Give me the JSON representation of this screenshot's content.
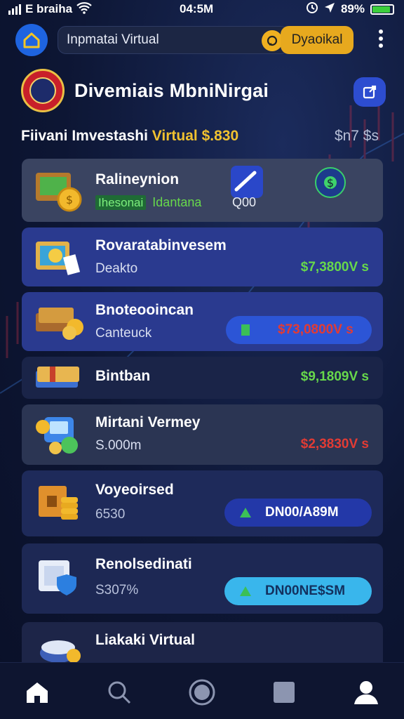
{
  "status": {
    "carrier": "E braiha",
    "time": "04:5M",
    "battery": "89%",
    "battery_level": 0.89
  },
  "topbar": {
    "search_text": "Inpmatai Virtual",
    "action_label": "Dyaoikal"
  },
  "header": {
    "title": "Divemiais MbniNirgai"
  },
  "summary": {
    "label": "Fiivani Imvestashi",
    "highlight": "Virtual $.830",
    "right_text": "$n7 $s"
  },
  "cards": [
    {
      "title": "Ralineynion",
      "sub_badge": "Ihesonai",
      "sub_text": "Idantana",
      "value": "Q00",
      "bg": "#3a4461"
    },
    {
      "title": "Rovaratabinvesem",
      "sub": "Deakto",
      "value": "$7,3800V s",
      "value_color": "#67d84b",
      "bg": "#2a3a8f"
    },
    {
      "title": "Bnoteooincan",
      "sub": "Canteuck",
      "value": "$73,0800V s",
      "value_color": "#e23b34",
      "bg": "#2a3a8f"
    },
    {
      "title": "Bintban",
      "value": "$9,1809V s",
      "value_color": "#67d84b",
      "bg": "#1a2448"
    },
    {
      "title": "Mirtani Vermey",
      "sub": "S.000m",
      "value": "$2,3830V s",
      "value_color": "#e23b34",
      "bg": "#2b3553"
    },
    {
      "title": "Voyeoirsed",
      "sub": "6530",
      "button": "DN00/A89M",
      "bg": "#1e2a5a"
    },
    {
      "title": "Renolsedinati",
      "sub": "S307%",
      "button": "DN00NE$SM",
      "bg": "#1d2854"
    },
    {
      "title": "Liakaki Virtual",
      "bg": "#1d2548"
    }
  ],
  "colors": {
    "accent_blue": "#1e64e0",
    "accent_gold": "#e7a91e",
    "gain_green": "#67d84b",
    "loss_red": "#e23b34"
  },
  "icons": [
    "home-icon",
    "search-icon",
    "record-icon",
    "square-icon",
    "profile-icon"
  ]
}
